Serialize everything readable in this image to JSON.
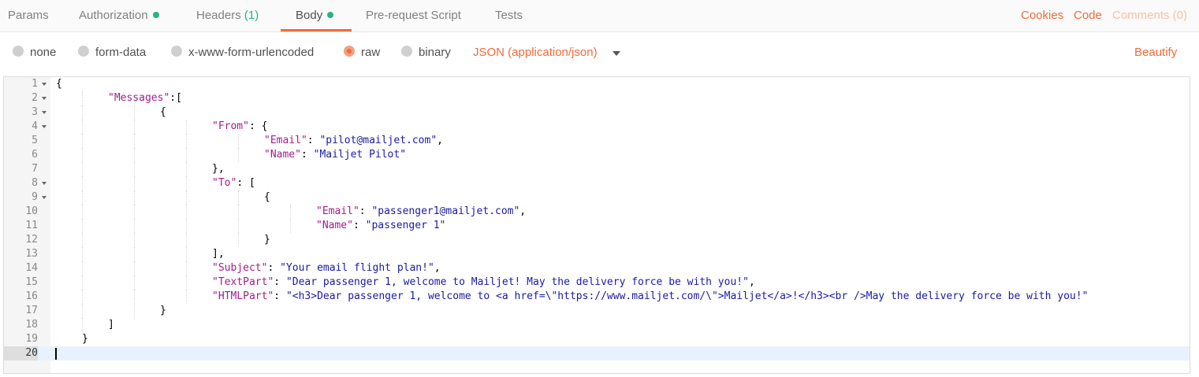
{
  "tabs": [
    {
      "label": "Params"
    },
    {
      "label": "Authorization"
    },
    {
      "label": "Headers",
      "count": "(1)"
    },
    {
      "label": "Body"
    },
    {
      "label": "Pre-request Script"
    },
    {
      "label": "Tests"
    }
  ],
  "right_links": {
    "cookies": "Cookies",
    "code": "Code",
    "comments": "Comments (0)"
  },
  "body_types": [
    {
      "label": "none",
      "selected": false
    },
    {
      "label": "form-data",
      "selected": false
    },
    {
      "label": "x-www-form-urlencoded",
      "selected": false
    },
    {
      "label": "raw",
      "selected": true
    },
    {
      "label": "binary",
      "selected": false
    }
  ],
  "content_type": "JSON (application/json)",
  "beautify_label": "Beautify",
  "colors": {
    "accent": "#f26b3a",
    "status_dot": "#26b47f",
    "json_key": "#a11d8c",
    "json_string": "#1a1aa6"
  },
  "editor": {
    "current_line": 20,
    "lines": [
      {
        "n": "1",
        "fold": true,
        "indent": 0,
        "tokens": [
          {
            "t": "p",
            "v": "{"
          }
        ]
      },
      {
        "n": "2",
        "fold": true,
        "indent": 1,
        "tokens": [
          {
            "t": "k",
            "v": "\"Messages\""
          },
          {
            "t": "p",
            "v": ":["
          }
        ]
      },
      {
        "n": "3",
        "fold": true,
        "indent": 2,
        "tokens": [
          {
            "t": "p",
            "v": "{"
          }
        ]
      },
      {
        "n": "4",
        "fold": true,
        "indent": 3,
        "tokens": [
          {
            "t": "k",
            "v": "\"From\""
          },
          {
            "t": "p",
            "v": ": {"
          }
        ]
      },
      {
        "n": "5",
        "fold": false,
        "indent": 4,
        "tokens": [
          {
            "t": "k",
            "v": "\"Email\""
          },
          {
            "t": "p",
            "v": ": "
          },
          {
            "t": "s",
            "v": "\"pilot@mailjet.com\""
          },
          {
            "t": "p",
            "v": ","
          }
        ]
      },
      {
        "n": "6",
        "fold": false,
        "indent": 4,
        "tokens": [
          {
            "t": "k",
            "v": "\"Name\""
          },
          {
            "t": "p",
            "v": ": "
          },
          {
            "t": "s",
            "v": "\"Mailjet Pilot\""
          }
        ]
      },
      {
        "n": "7",
        "fold": false,
        "indent": 3,
        "tokens": [
          {
            "t": "p",
            "v": "},"
          }
        ]
      },
      {
        "n": "8",
        "fold": true,
        "indent": 3,
        "tokens": [
          {
            "t": "k",
            "v": "\"To\""
          },
          {
            "t": "p",
            "v": ": ["
          }
        ]
      },
      {
        "n": "9",
        "fold": true,
        "indent": 4,
        "tokens": [
          {
            "t": "p",
            "v": "{"
          }
        ]
      },
      {
        "n": "10",
        "fold": false,
        "indent": 5,
        "tokens": [
          {
            "t": "k",
            "v": "\"Email\""
          },
          {
            "t": "p",
            "v": ": "
          },
          {
            "t": "s",
            "v": "\"passenger1@mailjet.com\""
          },
          {
            "t": "p",
            "v": ","
          }
        ]
      },
      {
        "n": "11",
        "fold": false,
        "indent": 5,
        "tokens": [
          {
            "t": "k",
            "v": "\"Name\""
          },
          {
            "t": "p",
            "v": ": "
          },
          {
            "t": "s",
            "v": "\"passenger 1\""
          }
        ]
      },
      {
        "n": "12",
        "fold": false,
        "indent": 4,
        "tokens": [
          {
            "t": "p",
            "v": "}"
          }
        ]
      },
      {
        "n": "13",
        "fold": false,
        "indent": 3,
        "tokens": [
          {
            "t": "p",
            "v": "],"
          }
        ]
      },
      {
        "n": "14",
        "fold": false,
        "indent": 3,
        "tokens": [
          {
            "t": "k",
            "v": "\"Subject\""
          },
          {
            "t": "p",
            "v": ": "
          },
          {
            "t": "s",
            "v": "\"Your email flight plan!\""
          },
          {
            "t": "p",
            "v": ","
          }
        ]
      },
      {
        "n": "15",
        "fold": false,
        "indent": 3,
        "tokens": [
          {
            "t": "k",
            "v": "\"TextPart\""
          },
          {
            "t": "p",
            "v": ": "
          },
          {
            "t": "s",
            "v": "\"Dear passenger 1, welcome to Mailjet! May the delivery force be with you!\""
          },
          {
            "t": "p",
            "v": ","
          }
        ]
      },
      {
        "n": "16",
        "fold": false,
        "indent": 3,
        "tokens": [
          {
            "t": "k",
            "v": "\"HTMLPart\""
          },
          {
            "t": "p",
            "v": ": "
          },
          {
            "t": "s",
            "v": "\"<h3>Dear passenger 1, welcome to <a href=\\\"https://www.mailjet.com/\\\">Mailjet</a>!</h3><br />May the delivery force be with you!\""
          }
        ]
      },
      {
        "n": "17",
        "fold": false,
        "indent": 2,
        "tokens": [
          {
            "t": "p",
            "v": "}"
          }
        ]
      },
      {
        "n": "18",
        "fold": false,
        "indent": 1,
        "tokens": [
          {
            "t": "p",
            "v": "]"
          }
        ]
      },
      {
        "n": "19",
        "fold": false,
        "indent": 0.5,
        "tokens": [
          {
            "t": "p",
            "v": "}"
          }
        ]
      },
      {
        "n": "20",
        "fold": false,
        "indent": 0,
        "tokens": []
      }
    ]
  }
}
